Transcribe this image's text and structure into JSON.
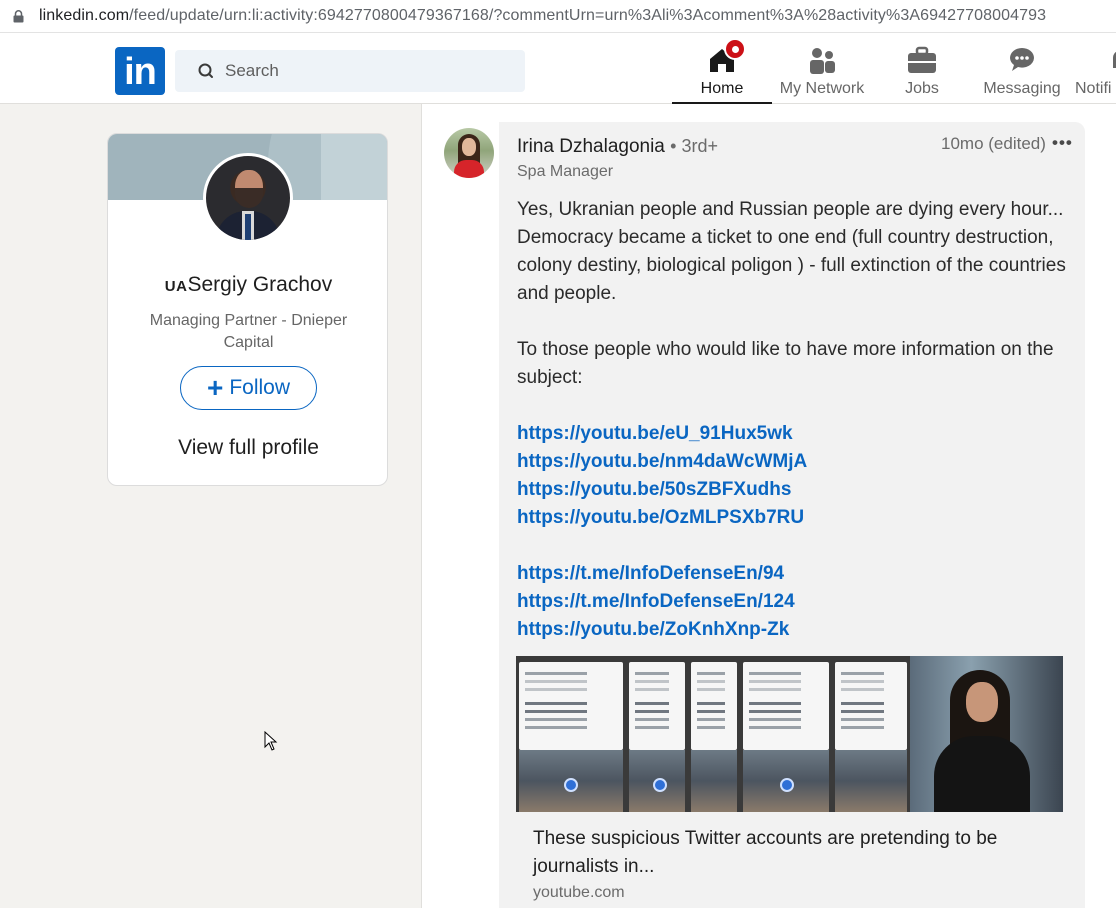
{
  "browser": {
    "url_host": "linkedin.com",
    "url_path": "/feed/update/urn:li:activity:6942770800479367168/?commentUrn=urn%3Ali%3Acomment%3A%28activity%3A69427708004793"
  },
  "header": {
    "logo_text": "in",
    "search_placeholder": "Search",
    "nav": [
      {
        "label": "Home",
        "icon": "home-icon",
        "active": true
      },
      {
        "label": "My Network",
        "icon": "network-icon"
      },
      {
        "label": "Jobs",
        "icon": "briefcase-icon"
      },
      {
        "label": "Messaging",
        "icon": "messaging-icon"
      },
      {
        "label": "Notifi",
        "icon": "bell-icon"
      }
    ]
  },
  "profile": {
    "flag_prefix": "UA",
    "name": "Sergiy Grachov",
    "title": "Managing Partner - Dnieper Capital",
    "follow_label": "Follow",
    "view_full_profile": "View full profile"
  },
  "comment": {
    "author": "Irina Dzhalagonia",
    "degree": "• 3rd+",
    "role": "Spa Manager",
    "time": "10mo (edited)",
    "more": "•••",
    "paragraph1": "Yes, Ukranian people and Russian people are dying every hour... Democracy became a ticket to one end (full country destruction, colony destiny, biological poligon ) - full extinction of the countries and people.",
    "paragraph2": "To those people who would like to have more information on the subject:",
    "links_group1": [
      "https://youtu.be/eU_91Hux5wk",
      "https://youtu.be/nm4daWcWMjA",
      "https://youtu.be/50sZBFXudhs",
      "https://youtu.be/OzMLPSXb7RU"
    ],
    "links_group2": [
      "https://t.me/InfoDefenseEn/94",
      "https://t.me/InfoDefenseEn/124",
      "https://youtu.be/ZoKnhXnp-Zk"
    ],
    "preview": {
      "title": "These suspicious Twitter accounts are pretending to be journalists in...",
      "domain": "youtube.com"
    }
  },
  "colors": {
    "brand": "#0a66c2",
    "badge": "#cc1016",
    "page_bg": "#f3f2ef"
  }
}
